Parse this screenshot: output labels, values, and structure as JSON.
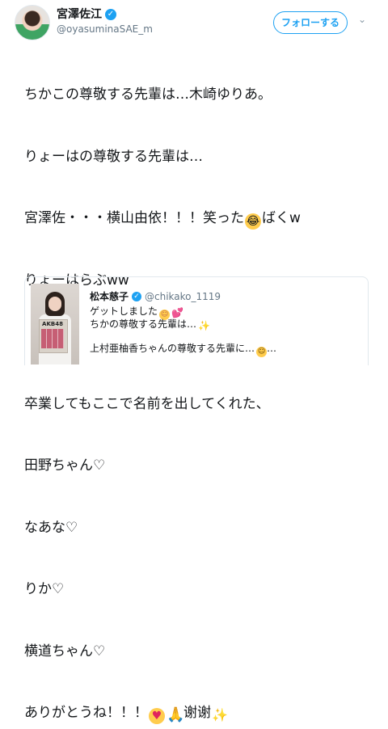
{
  "user": {
    "display_name": "宮澤佐江",
    "handle": "@oyasuminaSAE_m",
    "verified_symbol": "✓"
  },
  "follow_label": "フォローする",
  "menu_icon": "chevron-down-icon",
  "tweet": {
    "line1": "ちかこの尊敬する先輩は…木崎ゆりあ。",
    "line2": "りょーはの尊敬する先輩は…",
    "line3_text": "宮澤佐・・・横山由依！！！笑った",
    "line3_tail": "ばくw",
    "line4": "りょーはらぶww",
    "line6": "卒業してもここで名前を出してくれた、",
    "line7": "田野ちゃん♡",
    "line8": "なあな♡",
    "line9": "りか♡",
    "line10": "横道ちゃん♡",
    "line11_text": "ありがとうね！！！",
    "line11_tail": "谢谢"
  },
  "emojis": {
    "rofl": "rolling-on-floor-laughing",
    "hearts_eyes": "heart-eyes",
    "pray": "folded-hands",
    "sparkles": "sparkles"
  },
  "quote": {
    "name": "松本慈子",
    "handle": "@chikako_1119",
    "verified_symbol": "✓",
    "line1": "ゲットしました",
    "line2": "ちかの尊敬する先輩は…",
    "line3": "上村亜柚香ちゃんの尊敬する先輩に…",
    "line3_tail": "…",
    "book_title": "AKB48"
  },
  "colors": {
    "accent": "#1da1f2",
    "text": "#14171a",
    "secondary": "#657786",
    "border": "#e1e8ed"
  }
}
